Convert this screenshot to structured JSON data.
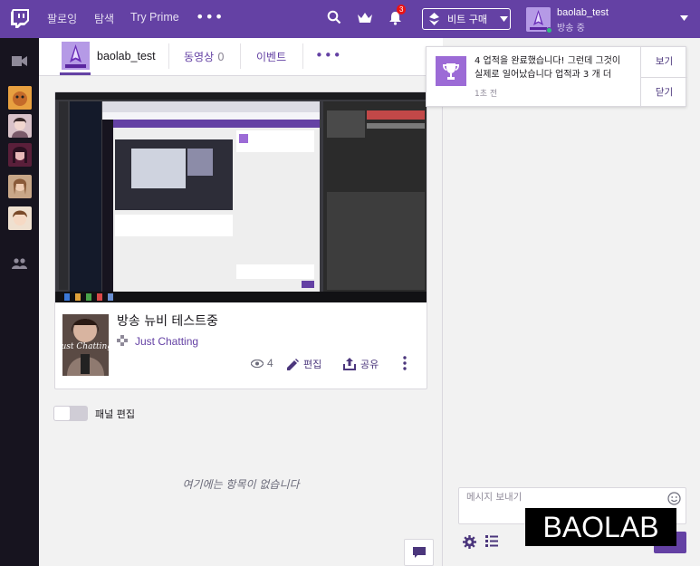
{
  "topnav": {
    "links": [
      "팔로잉",
      "탐색",
      "Try Prime"
    ],
    "notification_count": "3",
    "bits_button": "비트 구매",
    "user": {
      "name": "baolab_test",
      "status": "방송 중"
    }
  },
  "channel": {
    "name": "baolab_test",
    "tabs": [
      {
        "label": "동영상",
        "count": "0"
      },
      {
        "label": "이벤트"
      }
    ]
  },
  "video": {
    "title": "방송 뉴비 테스트중",
    "game": "Just Chatting",
    "game_art_text": "Just Chatting",
    "view_count": "4",
    "edit_label": "편집",
    "share_label": "공유"
  },
  "panel": {
    "toggle_label": "패널 편집"
  },
  "empty_message": "여기에는 항목이 없습니다",
  "chat": {
    "placeholder": "메시지 보내기"
  },
  "notification": {
    "text": "4 업적을 완료했습니다! 그런데 그것이 실제로 일어났습니다 업적과 3 개 더",
    "time": "1초 전",
    "view_label": "보기",
    "close_label": "닫기"
  },
  "watermark": "BAOLAB",
  "colors": {
    "brand": "#6441a4",
    "rail": "#17141f",
    "badge": "#ec1313"
  }
}
